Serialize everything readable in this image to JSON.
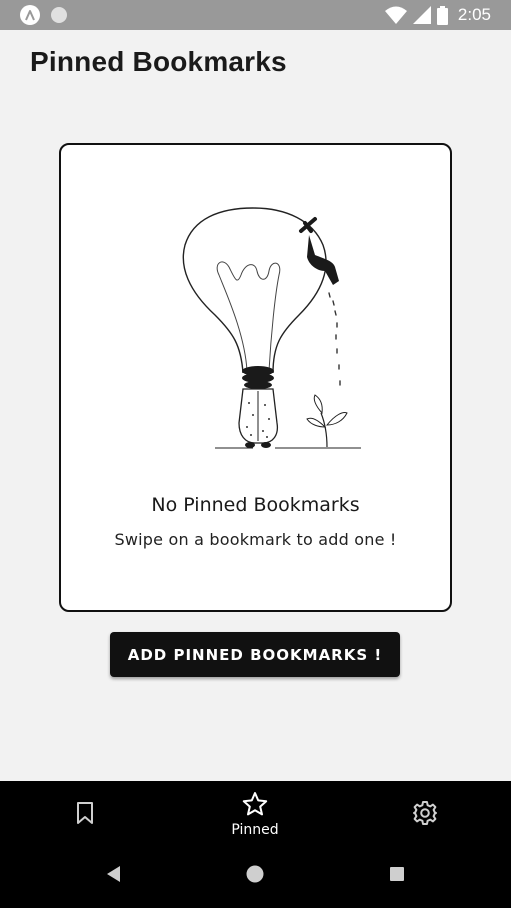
{
  "status_bar": {
    "time": "2:05",
    "icons": [
      "app-a-icon",
      "circle-notification-icon",
      "wifi-icon",
      "signal-icon",
      "battery-icon"
    ]
  },
  "header": {
    "title": "Pinned Bookmarks"
  },
  "empty_state": {
    "illustration": "lightbulb-faucet-illustration",
    "title": "No Pinned Bookmarks",
    "subtitle": "Swipe on a bookmark to add one !"
  },
  "primary_action": {
    "label": "ADD PINNED BOOKMARKS !"
  },
  "bottom_nav": {
    "items": [
      {
        "icon": "bookmark-icon",
        "label": "",
        "active": false
      },
      {
        "icon": "star-icon",
        "label": "Pinned",
        "active": true
      },
      {
        "icon": "gear-icon",
        "label": "",
        "active": false
      }
    ]
  },
  "system_nav": {
    "icons": [
      "back-icon",
      "home-icon",
      "recents-icon"
    ]
  },
  "colors": {
    "status_bar": "#999999",
    "background": "#f2f2f2",
    "card_border": "#111111",
    "button": "#111111",
    "nav_bar": "#000000"
  }
}
